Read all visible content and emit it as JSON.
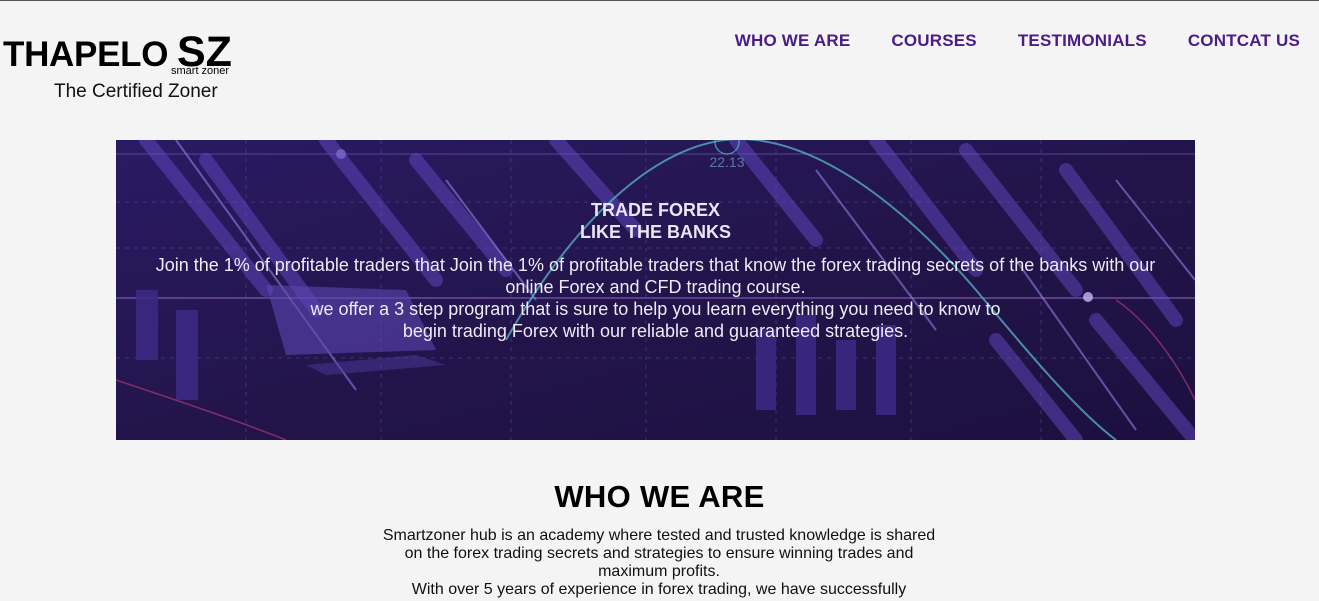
{
  "brand": {
    "name": "THAPELO",
    "logo": "SZ",
    "logo_sub": "smart zoner",
    "tagline": "The Certified Zoner"
  },
  "nav": {
    "items": [
      "WHO WE ARE",
      "COURSES",
      "TESTIMONIALS",
      "CONTCAT US"
    ]
  },
  "hero": {
    "title_line1": "TRADE FOREX",
    "title_line2": "LIKE THE BANKS",
    "text_1": "Join the 1% of profitable traders that Join the 1% of profitable traders that know the forex trading secrets of the banks with our online Forex and CFD trading course.",
    "text_2": "we offer a 3 step program that is sure to help you learn everything you need to know to begin trading Forex with our reliable and guaranteed strategies.",
    "chart_label": "22.13"
  },
  "who": {
    "title": "WHO WE ARE",
    "text_1": "Smartzoner hub is an academy where tested and trusted knowledge is shared on the forex trading secrets and strategies to ensure winning trades and maximum profits.",
    "text_2": "With over 5 years of experience in forex trading, we have successfully"
  },
  "colors": {
    "nav": "#4a1c86",
    "hero_bg": "#231451",
    "page_bg": "#f4f4f4"
  }
}
